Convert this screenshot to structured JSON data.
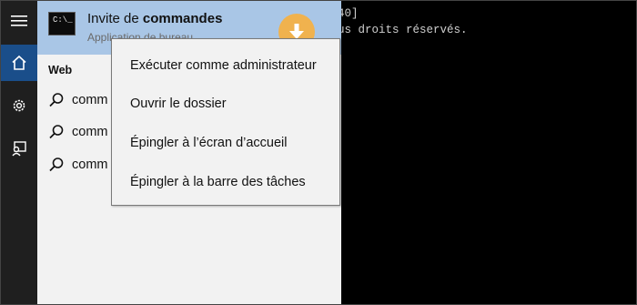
{
  "console": {
    "line1": "40]",
    "line2": "us droits réservés."
  },
  "rail": {
    "icons": [
      "hamburger-icon",
      "home-icon",
      "gear-icon",
      "person-feedback-icon"
    ],
    "active_color": "#1a4e8a"
  },
  "best_match": {
    "title_prefix": "Invite de ",
    "title_bold": "commandes",
    "subtitle": "Application de bureau",
    "icon_text": "C:\\_"
  },
  "web": {
    "section_label": "Web",
    "results": [
      "comm",
      "comm",
      "comm"
    ]
  },
  "context_menu": {
    "items": [
      "Exécuter comme administrateur",
      "Ouvrir le dossier",
      "Épingler à l’écran d’accueil",
      "Épingler à la barre des tâches"
    ]
  },
  "colors": {
    "highlight": "#a9c6e6",
    "badge": "#f0b24e"
  }
}
